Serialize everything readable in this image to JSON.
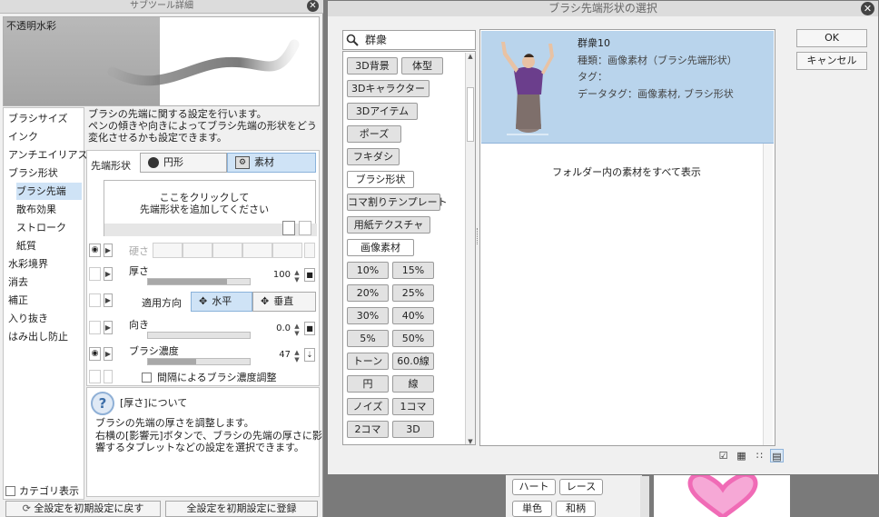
{
  "left_panel": {
    "title": "サブツール詳細",
    "preset_name": "不透明水彩",
    "categories": [
      {
        "label": "ブラシサイズ"
      },
      {
        "label": "インク"
      },
      {
        "label": "アンチエイリアス"
      },
      {
        "label": "ブラシ形状"
      },
      {
        "label": "ブラシ先端",
        "selected": true
      },
      {
        "label": "散布効果"
      },
      {
        "label": "ストローク"
      },
      {
        "label": "紙質"
      },
      {
        "label": "水彩境界"
      },
      {
        "label": "消去"
      },
      {
        "label": "補正"
      },
      {
        "label": "入り抜き"
      },
      {
        "label": "はみ出し防止"
      }
    ],
    "category_display": "カテゴリ表示",
    "description": [
      "ブラシの先端に関する設定を行います。",
      "ペンの傾きや向きによってブラシ先端の形状をどう",
      "変化させるかも設定できます。"
    ],
    "tip_shape_label": "先端形状",
    "tip_circle": "円形",
    "tip_material": "素材",
    "add_tip_text": [
      "ここをクリックして",
      "先端形状を追加してください"
    ],
    "hardness_label": "硬さ",
    "thickness_label": "厚さ",
    "thickness_value": "100",
    "thickness_fill": 0.78,
    "apply_direction_label": "適用方向",
    "horizontal": "水平",
    "vertical": "垂直",
    "direction_label": "向き",
    "direction_value": "0.0",
    "density_label": "ブラシ濃度",
    "density_value": "47",
    "density_fill": 0.47,
    "interval_density": "間隔によるブラシ濃度調整",
    "help_title": "[厚さ]について",
    "help_body": [
      "ブラシの先端の厚さを調整します。",
      "右横の[影響元]ボタンで、ブラシの先端の厚さに影",
      "響するタブレットなどの設定を選択できます。"
    ],
    "reset_button": "全設定を初期設定に戻す",
    "register_button": "全設定を初期設定に登録"
  },
  "dialog": {
    "title": "ブラシ先端形状の選択",
    "search_value": "群衆",
    "tags": [
      [
        "3D背景",
        "体型"
      ],
      [
        "3Dキャラクター"
      ],
      [
        "3Dアイテム"
      ],
      [
        "ポーズ"
      ],
      [
        "フキダシ"
      ],
      [
        "ブラシ形状"
      ],
      [
        "コマ割りテンプレート"
      ],
      [
        "用紙テクスチャ"
      ],
      [
        "画像素材"
      ],
      [
        "10%",
        "15%"
      ],
      [
        "20%",
        "25%"
      ],
      [
        "30%",
        "40%"
      ],
      [
        "5%",
        "50%"
      ],
      [
        "トーン",
        "60.0線"
      ],
      [
        "円",
        "線"
      ],
      [
        "ノイズ",
        "1コマ"
      ],
      [
        "2コマ",
        "3D"
      ]
    ],
    "result": {
      "name": "群衆10",
      "kind": "種類：画像素材（ブラシ先端形状）",
      "tag": "タグ：",
      "data_tag": "データタグ：画像素材, ブラシ形状"
    },
    "show_all": "フォルダー内の素材をすべて表示",
    "ok": "OK",
    "cancel": "キャンセル"
  },
  "background": {
    "tabs_row1": [
      "ハート",
      "レース"
    ],
    "tabs_row2": [
      "単色",
      "和柄"
    ],
    "heart_color": "#f06bb6"
  }
}
